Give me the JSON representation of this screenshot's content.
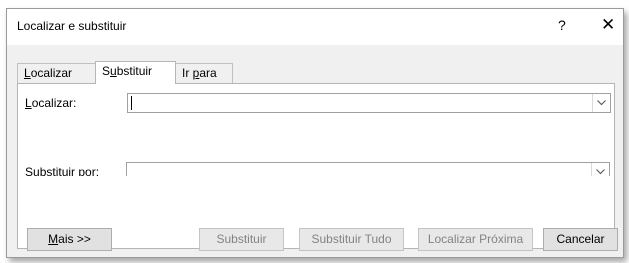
{
  "window": {
    "title": "Localizar e substituir",
    "help_label": "?",
    "close_label": "✕"
  },
  "tabs": [
    {
      "label_pre": "",
      "mnemonic": "L",
      "label_post": "ocalizar"
    },
    {
      "label_pre": "S",
      "mnemonic": "u",
      "label_post": "bstituir"
    },
    {
      "label_pre": "Ir ",
      "mnemonic": "p",
      "label_post": "ara"
    }
  ],
  "find": {
    "label_pre": "",
    "mnemonic": "L",
    "label_post": "ocalizar:",
    "value": ""
  },
  "replace": {
    "label_pre": "Su",
    "mnemonic": "b",
    "label_post": "stituir por:",
    "value": ""
  },
  "buttons": {
    "more": {
      "mnemonic": "M",
      "label_post": "ais >>"
    },
    "replace": "Substituir",
    "replace_all": "Substituir Tudo",
    "find_next": "Localizar Próxima",
    "cancel": "Cancelar"
  },
  "icons": {
    "dropdown": "chevron-down-icon",
    "close": "close-icon"
  }
}
